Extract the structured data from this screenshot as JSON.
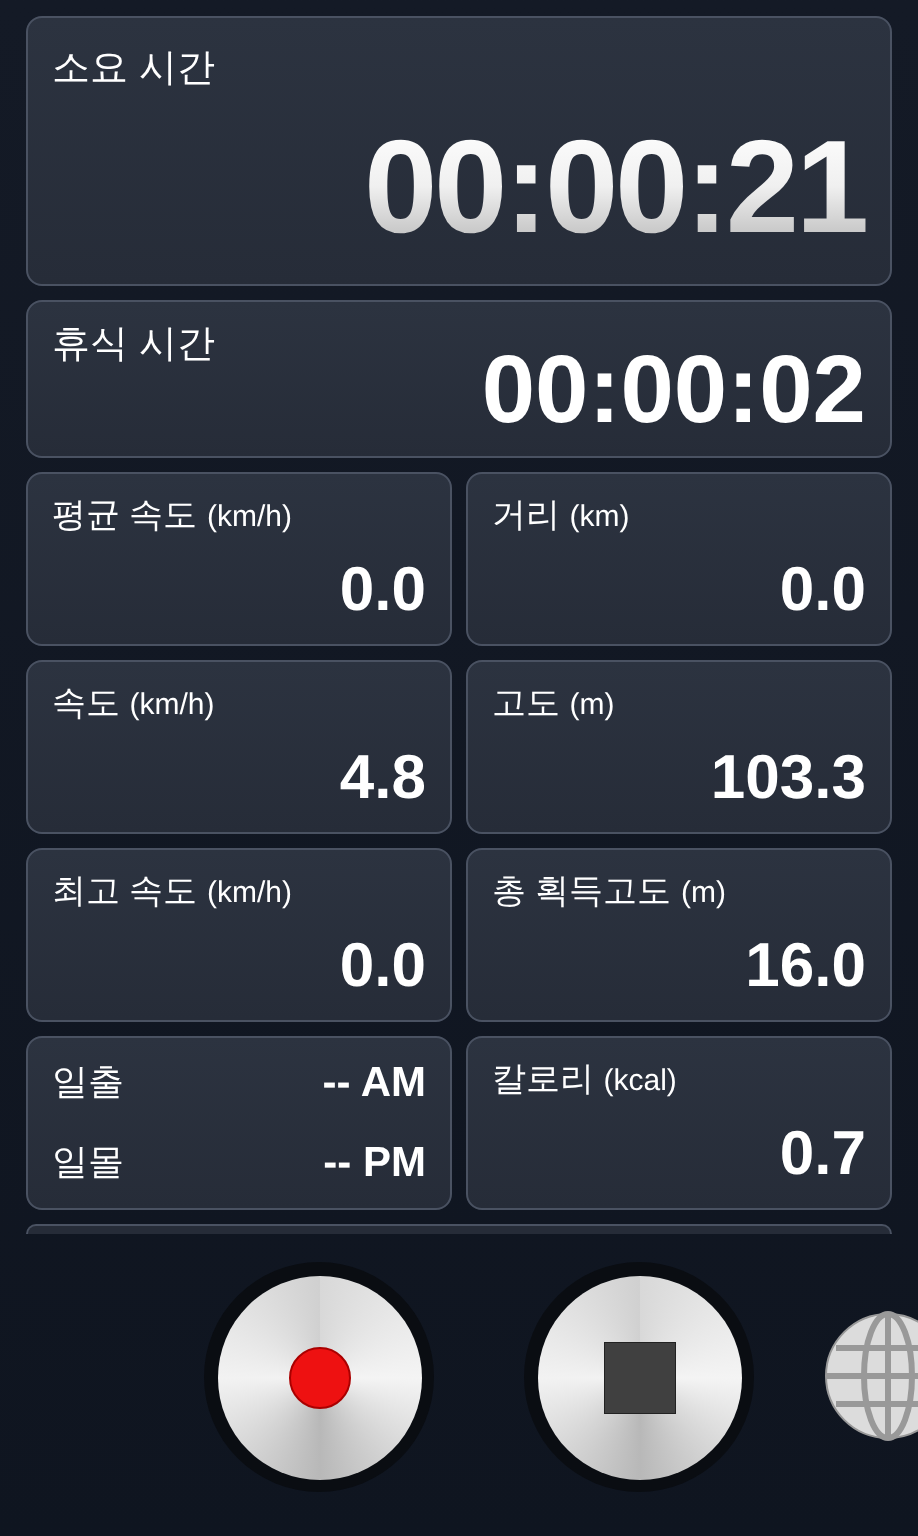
{
  "elapsed": {
    "label": "소요 시간",
    "value": "00:00:21"
  },
  "rest": {
    "label": "휴식 시간",
    "value": "00:00:02"
  },
  "stats": [
    {
      "kind": "metric",
      "label": "평균 속도",
      "unit": "(km/h)",
      "value": "0.0"
    },
    {
      "kind": "metric",
      "label": "거리",
      "unit": "(km)",
      "value": "0.0"
    },
    {
      "kind": "metric",
      "label": "속도",
      "unit": "(km/h)",
      "value": "4.8"
    },
    {
      "kind": "metric",
      "label": "고도",
      "unit": "(m)",
      "value": "103.3"
    },
    {
      "kind": "metric",
      "label": "최고 속도",
      "unit": "(km/h)",
      "value": "0.0"
    },
    {
      "kind": "metric",
      "label": "총 획득고도",
      "unit": "(m)",
      "value": "16.0"
    },
    {
      "kind": "sun",
      "rows": [
        {
          "label": "일출",
          "value": "-- AM"
        },
        {
          "label": "일몰",
          "value": "-- PM"
        }
      ]
    },
    {
      "kind": "metric",
      "label": "칼로리",
      "unit": "(kcal)",
      "value": "0.7"
    }
  ]
}
